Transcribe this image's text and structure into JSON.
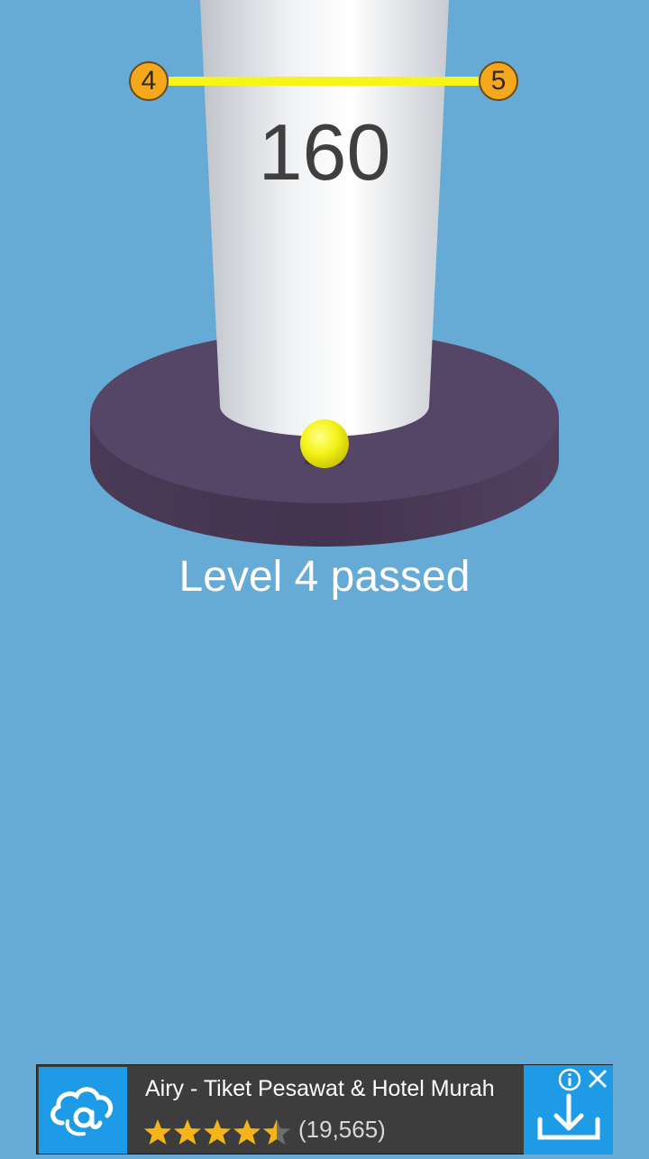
{
  "hud": {
    "score": "160",
    "current_level": "4",
    "next_level": "5",
    "level_progress": 1.0
  },
  "message": {
    "text": "Level 4 passed"
  },
  "ad": {
    "title": "Airy - Tiket Pesawat & Hotel Murah",
    "rating": 4.5,
    "rating_count": "(19,565)",
    "icons": [
      "airy-logo-icon",
      "star-icon",
      "info-icon",
      "close-icon",
      "download-icon"
    ]
  },
  "colors": {
    "background": "#66abd5",
    "tower": "#f2f2f2",
    "platform": "#4a3a5e",
    "ball": "#f5f51c",
    "progress": "#f7f41a",
    "level_node": "#f5a81c",
    "ad_accent": "#1e9be6"
  }
}
